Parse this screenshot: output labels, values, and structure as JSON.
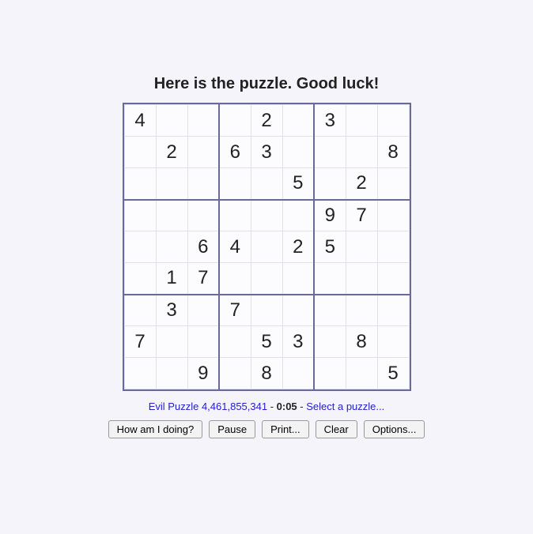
{
  "title": "Here is the puzzle. Good luck!",
  "grid": [
    [
      "4",
      "",
      "",
      "",
      "2",
      "",
      "3",
      "",
      ""
    ],
    [
      "",
      "2",
      "",
      "6",
      "3",
      "",
      "",
      "",
      "8"
    ],
    [
      "",
      "",
      "",
      "",
      "",
      "5",
      "",
      "2",
      ""
    ],
    [
      "",
      "",
      "",
      "",
      "",
      "",
      "9",
      "7",
      ""
    ],
    [
      "",
      "",
      "6",
      "4",
      "",
      "2",
      "5",
      "",
      ""
    ],
    [
      "",
      "1",
      "7",
      "",
      "",
      "",
      "",
      "",
      ""
    ],
    [
      "",
      "3",
      "",
      "7",
      "",
      "",
      "",
      "",
      ""
    ],
    [
      "7",
      "",
      "",
      "",
      "5",
      "3",
      "",
      "8",
      ""
    ],
    [
      "",
      "",
      "9",
      "",
      "8",
      "",
      "",
      "",
      "5"
    ]
  ],
  "status": {
    "puzzle_link": "Evil Puzzle 4,461,855,341",
    "sep1": " - ",
    "timer": "0:05",
    "sep2": " - ",
    "select_link": "Select a puzzle..."
  },
  "buttons": {
    "how": "How am I doing?",
    "pause": "Pause",
    "print": "Print...",
    "clear": "Clear",
    "options": "Options..."
  }
}
